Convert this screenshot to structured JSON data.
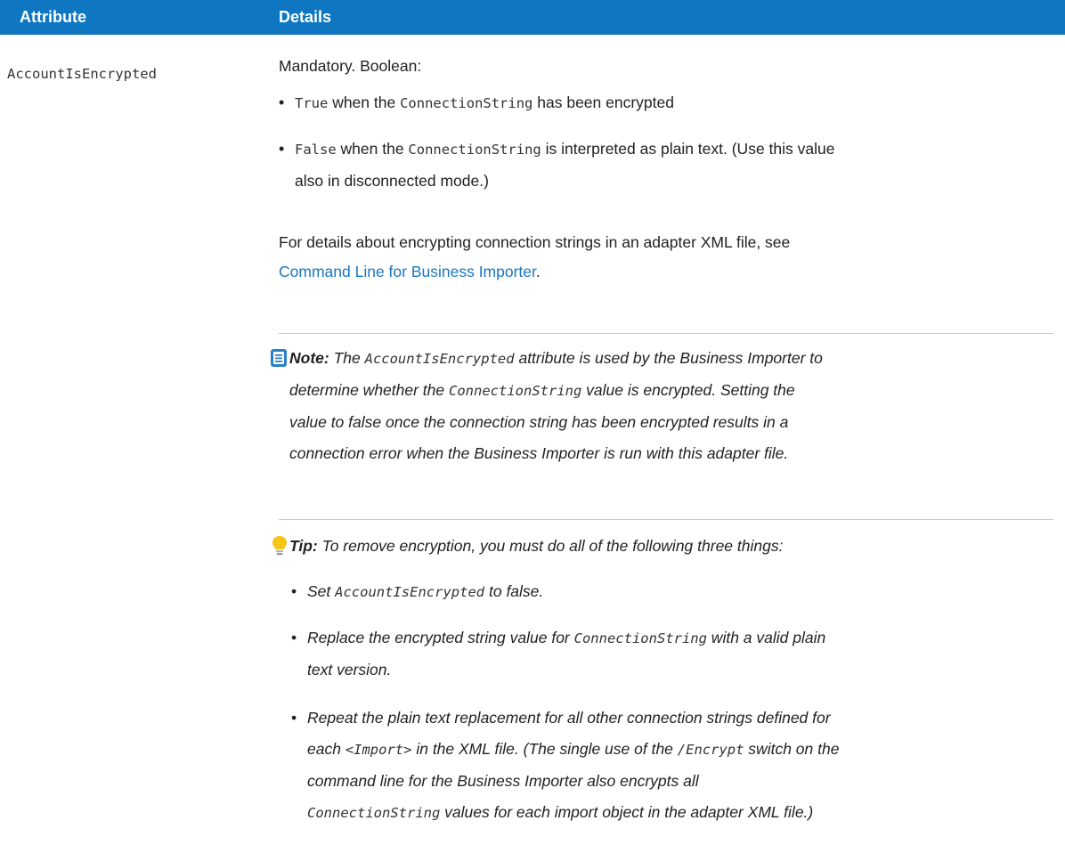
{
  "table": {
    "headers": {
      "attribute": "Attribute",
      "details": "Details"
    },
    "row": {
      "attribute": "AccountIsEncrypted",
      "intro": "Mandatory. Boolean:",
      "bullets": [
        {
          "code": "True",
          "text_a": " when the ",
          "code2": "ConnectionString",
          "text_b": " has been encrypted",
          "text_c": ""
        },
        {
          "code": "False",
          "text_a": " when the ",
          "code2": "ConnectionString",
          "text_b": " is interpreted as plain text. (Use this value",
          "text_c": "also in disconnected mode.)"
        }
      ],
      "details_para": {
        "line1": "For details about encrypting connection strings in an adapter XML file, see",
        "link": "Command Line for Business Importer",
        "tail": "."
      },
      "note": {
        "label": "Note:",
        "l1_pre": " The ",
        "l1_code": "AccountIsEncrypted",
        "l1_post": " attribute is used by the Business Importer to",
        "l2_pre": "determine whether the ",
        "l2_code": "ConnectionString",
        "l2_post": " value is encrypted. Setting the",
        "l3": "value to false once the connection string has been encrypted results in a",
        "l4": "connection error when the Business Importer is run with this adapter file."
      },
      "tip": {
        "label": "Tip:",
        "text": " To remove encryption, you must do all of the following three things:",
        "b1_pre": "Set ",
        "b1_code": "AccountIsEncrypted",
        "b1_post": " to false.",
        "b2_pre": "Replace the encrypted string value for ",
        "b2_code": "ConnectionString",
        "b2_post": " with a valid plain",
        "b2_l2": "text version.",
        "b3_l1": "Repeat the plain text replacement for all other connection strings defined for",
        "b3_l2_pre": "each ",
        "b3_l2_code": "<Import>",
        "b3_l2_mid": " in the XML file. (The single use of the ",
        "b3_l2_code2": "/Encrypt",
        "b3_l2_post": " switch on the",
        "b3_l3": "command line for the Business Importer also encrypts all",
        "b3_l4_code": "ConnectionString",
        "b3_l4_post": " values for each import object in the adapter XML file.)"
      }
    }
  },
  "colors": {
    "header_bg": "#0f77c1",
    "link": "#1a76c1",
    "tip_bulb": "#f5c518",
    "note_icon": "#2a7fc9"
  },
  "icons": {
    "note": "note-icon",
    "tip": "lightbulb-icon"
  }
}
